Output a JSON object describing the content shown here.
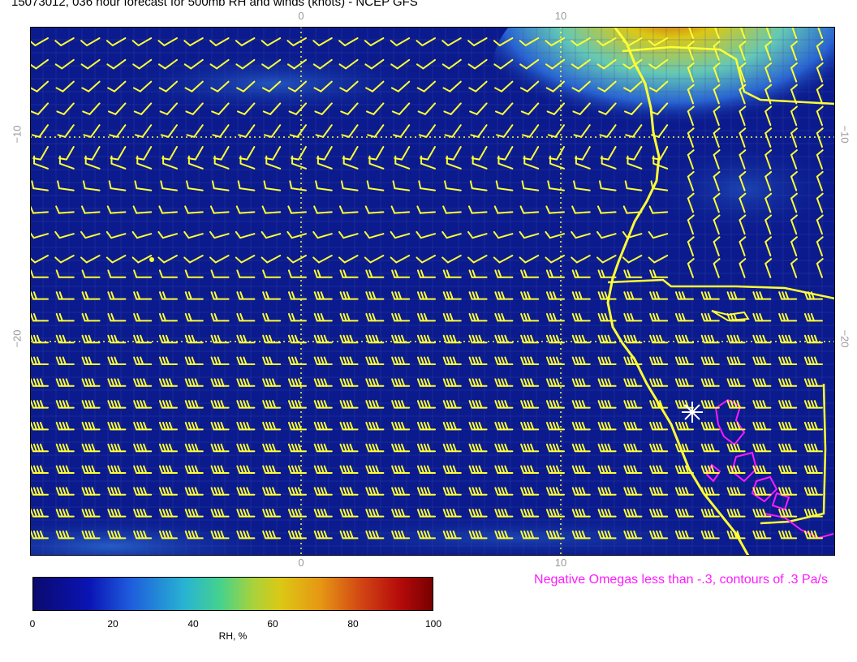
{
  "title": "15073012, 036 hour forecast for 500mb RH and winds (knots) - NCEP GFS",
  "map": {
    "lon_ticks_top": [
      "0",
      "10"
    ],
    "lon_ticks_bottom": [
      "0",
      "10"
    ],
    "lat_ticks_left": [
      "−10",
      "−20"
    ],
    "lat_ticks_right": [
      "−10",
      "−20"
    ],
    "background_color": "#0a1a8c",
    "coast_color": "#ffff33",
    "barb_color": "#ffff33",
    "omega_color": "#ff1aff",
    "station_marker": "asterisk-icon"
  },
  "colorbar": {
    "ticks": [
      "0",
      "20",
      "40",
      "60",
      "80",
      "100"
    ],
    "label": "RH, %"
  },
  "omega_note": "Negative Omegas less than -.3, contours of .3 Pa/s"
}
